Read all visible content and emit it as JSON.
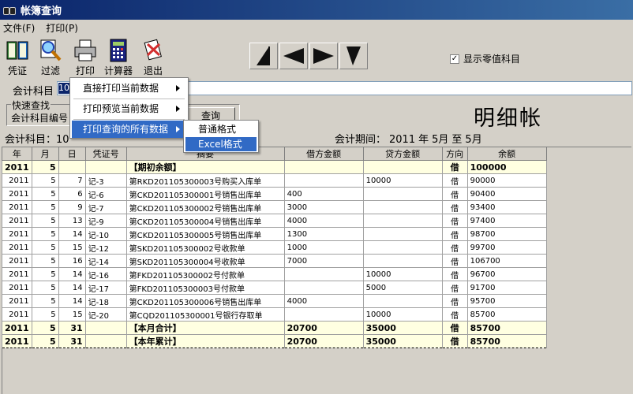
{
  "window": {
    "title": "帐簿查询"
  },
  "menu": {
    "file": "文件(F)",
    "print": "打印(P)"
  },
  "toolbar": {
    "voucher": "凭证",
    "filter": "过滤",
    "print": "打印",
    "calculator": "计算器",
    "exit": "退出"
  },
  "options": {
    "show_zero": "显示零值科目",
    "show_zero_checked": true
  },
  "query": {
    "account_label": "会计科目",
    "account_value_selected": "10",
    "quick_find": "快速查找",
    "account_code_label": "会计科目编号",
    "query_button": "查询"
  },
  "report": {
    "title": "明细帐",
    "account_line": "会计科目：10",
    "period_label": "会计期间：",
    "period_year": "2011",
    "year_unit": "年",
    "period_from": "5月",
    "to": "至",
    "period_to": "5月"
  },
  "print_menu": {
    "items": [
      "直接打印当前数据",
      "打印预览当前数据",
      "打印查询的所有数据"
    ],
    "submenu": [
      "普通格式",
      "Excel格式"
    ]
  },
  "table": {
    "headers": [
      "年",
      "月",
      "日",
      "凭证号",
      "摘要",
      "借方金额",
      "贷方金额",
      "方向",
      "余额"
    ],
    "rows": [
      [
        "2011",
        "5",
        "",
        "",
        "【期初余额】",
        "",
        "",
        "借",
        "100000"
      ],
      [
        "2011",
        "5",
        "7",
        "记-3",
        "第RKD201105300003号购买入库单",
        "",
        "10000",
        "借",
        "90000"
      ],
      [
        "2011",
        "5",
        "6",
        "记-6",
        "第CKD201105300001号销售出库单",
        "400",
        "",
        "借",
        "90400"
      ],
      [
        "2011",
        "5",
        "9",
        "记-7",
        "第CKD201105300002号销售出库单",
        "3000",
        "",
        "借",
        "93400"
      ],
      [
        "2011",
        "5",
        "13",
        "记-9",
        "第CKD201105300004号销售出库单",
        "4000",
        "",
        "借",
        "97400"
      ],
      [
        "2011",
        "5",
        "14",
        "记-10",
        "第CKD201105300005号销售出库单",
        "1300",
        "",
        "借",
        "98700"
      ],
      [
        "2011",
        "5",
        "15",
        "记-12",
        "第SKD201105300002号收款单",
        "1000",
        "",
        "借",
        "99700"
      ],
      [
        "2011",
        "5",
        "16",
        "记-14",
        "第SKD201105300004号收款单",
        "7000",
        "",
        "借",
        "106700"
      ],
      [
        "2011",
        "5",
        "14",
        "记-16",
        "第FKD201105300002号付款单",
        "",
        "10000",
        "借",
        "96700"
      ],
      [
        "2011",
        "5",
        "14",
        "记-17",
        "第FKD201105300003号付款单",
        "",
        "5000",
        "借",
        "91700"
      ],
      [
        "2011",
        "5",
        "14",
        "记-18",
        "第CKD201105300006号销售出库单",
        "4000",
        "",
        "借",
        "95700"
      ],
      [
        "2011",
        "5",
        "15",
        "记-20",
        "第CQD201105300001号银行存取单",
        "",
        "10000",
        "借",
        "85700"
      ],
      [
        "2011",
        "5",
        "31",
        "",
        "【本月合计】",
        "20700",
        "35000",
        "借",
        "85700"
      ],
      [
        "2011",
        "5",
        "31",
        "",
        "【本年累计】",
        "20700",
        "35000",
        "借",
        "85700"
      ]
    ],
    "bold_rows": [
      0,
      12,
      13
    ]
  }
}
